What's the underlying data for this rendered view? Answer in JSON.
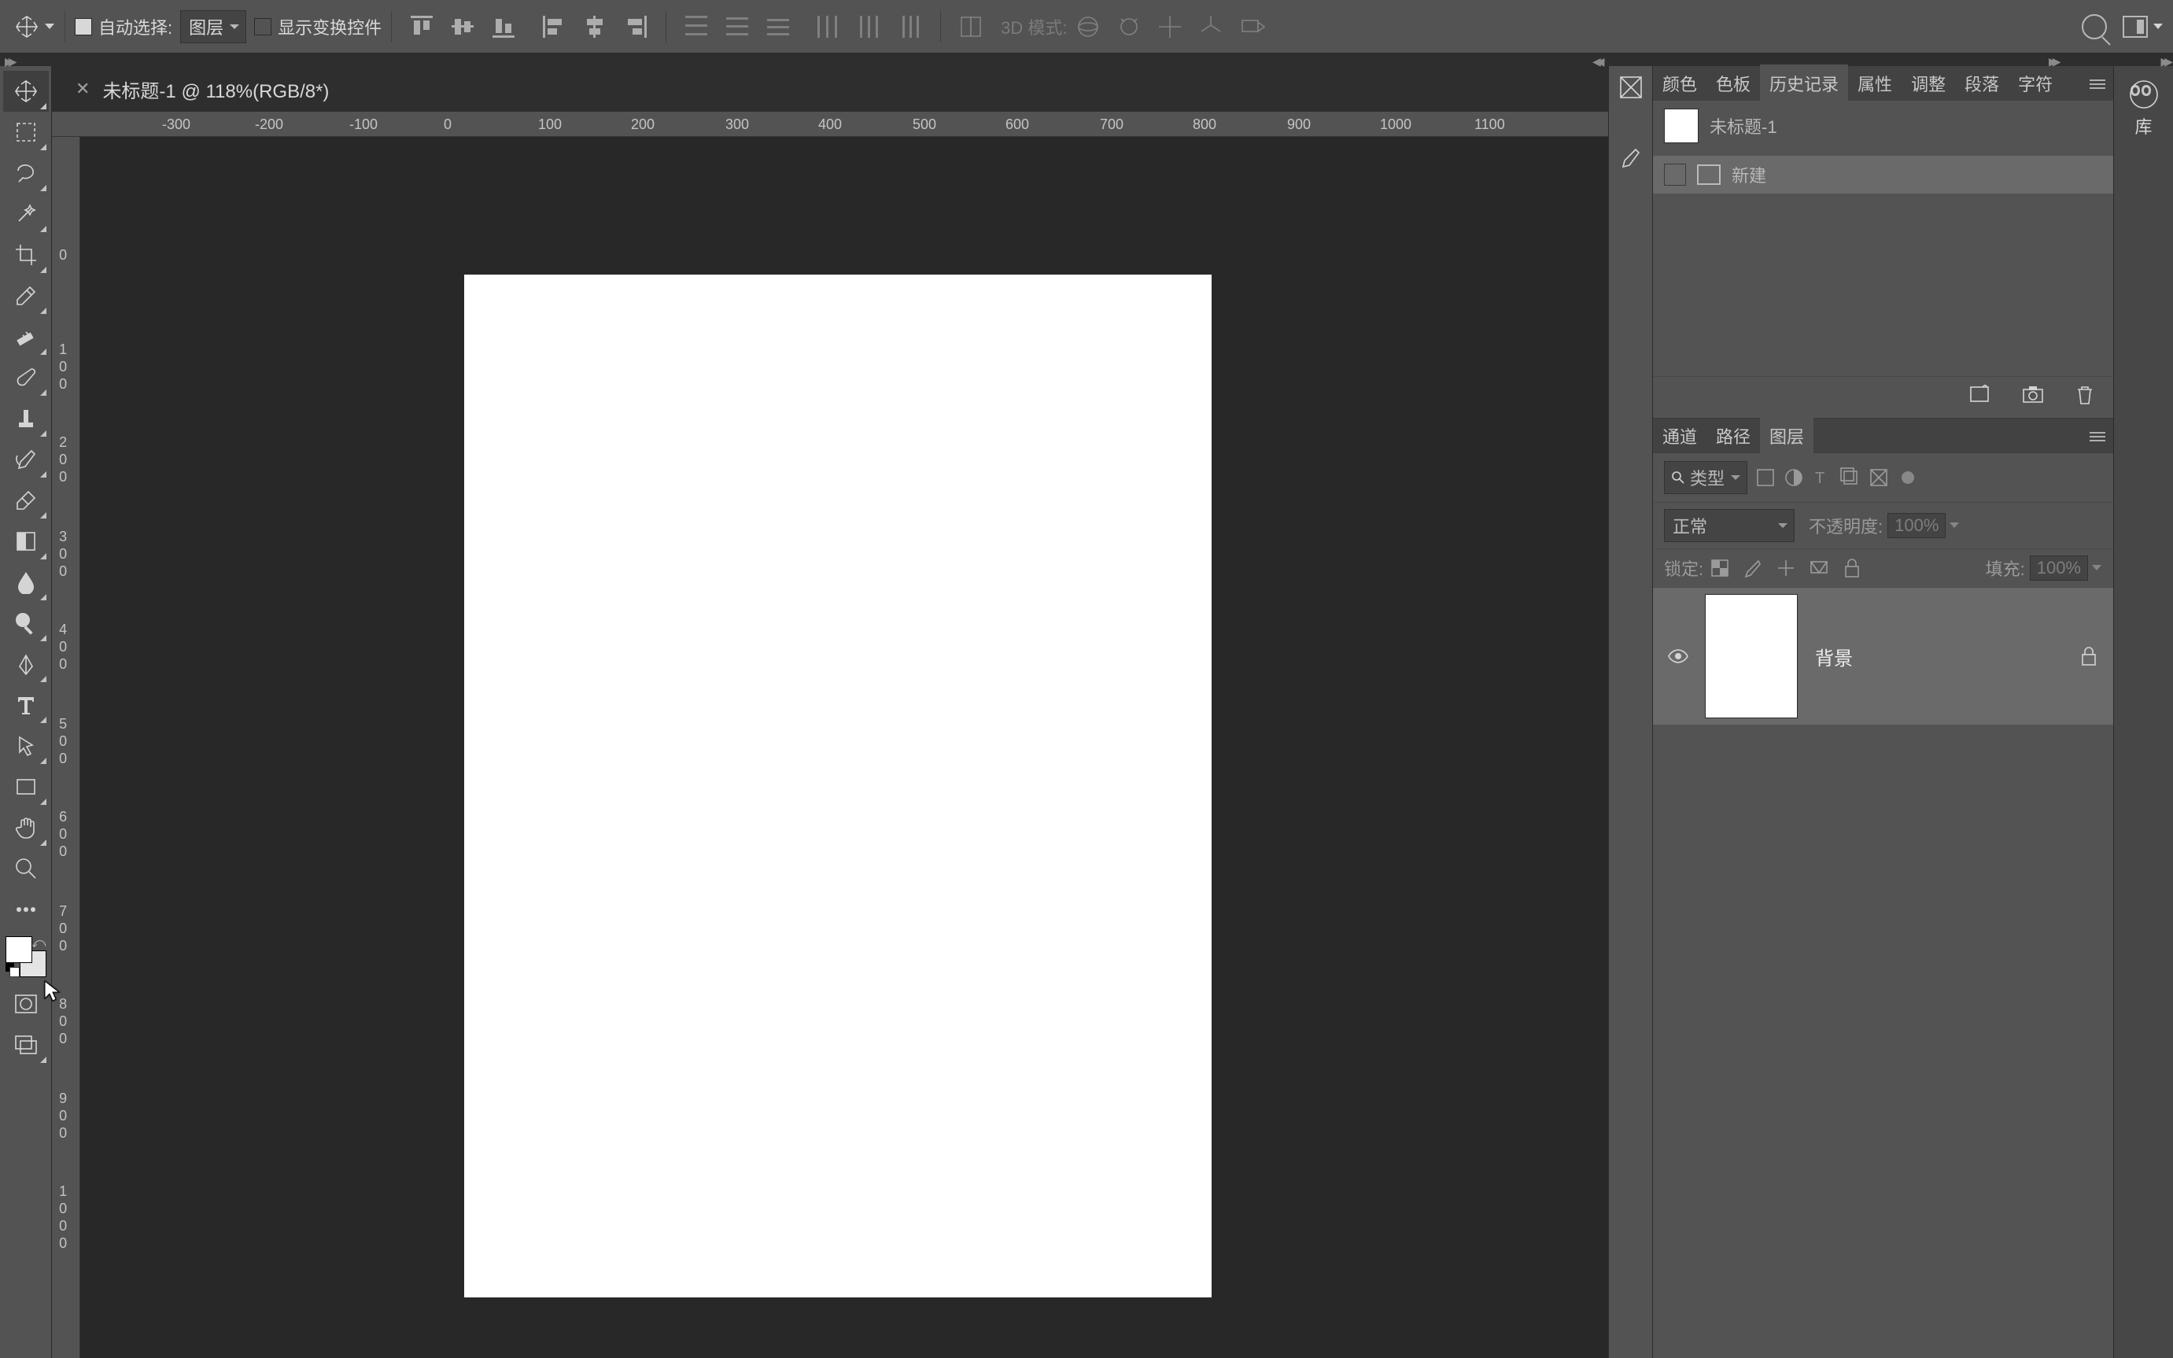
{
  "options": {
    "auto_select": "自动选择:",
    "select_scope": "图层",
    "show_transform": "显示变换控件",
    "mode3d": "3D 模式:"
  },
  "doc_tab": {
    "title": "未标题-1 @ 118%(RGB/8*)"
  },
  "ruler_h": [
    "-300",
    "-200",
    "-100",
    "0",
    "100",
    "200",
    "300",
    "400",
    "500",
    "600",
    "700",
    "800",
    "900",
    "1000",
    "1100"
  ],
  "ruler_v": [
    "0",
    "100",
    "200",
    "300",
    "400",
    "500",
    "600",
    "700",
    "800",
    "900",
    "1000"
  ],
  "panels_top": {
    "tabs": [
      "颜色",
      "色板",
      "历史记录",
      "属性",
      "调整",
      "段落",
      "字符"
    ],
    "active": 2
  },
  "history": {
    "doc_name": "未标题-1",
    "item": "新建"
  },
  "panels_bottom": {
    "tabs": [
      "通道",
      "路径",
      "图层"
    ],
    "active": 2
  },
  "layers": {
    "filter_label": "类型",
    "blend_mode": "正常",
    "opacity_label": "不透明度:",
    "opacity_value": "100%",
    "lock_label": "锁定:",
    "fill_label": "填充:",
    "fill_value": "100%",
    "layer_name": "背景"
  },
  "library": {
    "label": "库"
  }
}
